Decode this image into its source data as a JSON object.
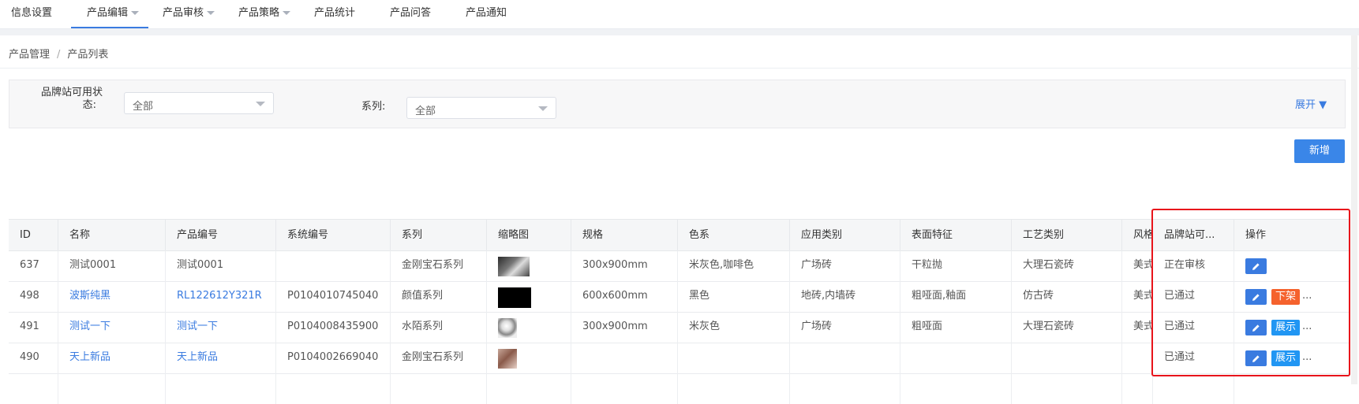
{
  "nav": {
    "items": [
      {
        "label": "信息设置",
        "caret": false,
        "active": false
      },
      {
        "label": "产品编辑",
        "caret": true,
        "active": true
      },
      {
        "label": "产品审核",
        "caret": true,
        "active": false
      },
      {
        "label": "产品策略",
        "caret": true,
        "active": false
      },
      {
        "label": "产品统计",
        "caret": false,
        "active": false
      },
      {
        "label": "产品问答",
        "caret": false,
        "active": false
      },
      {
        "label": "产品通知",
        "caret": false,
        "active": false
      }
    ]
  },
  "breadcrumb": {
    "root": "产品管理",
    "separator": "/",
    "current": "产品列表"
  },
  "filter": {
    "brand_status_label_line1": "品牌站可用状",
    "brand_status_label_line2": "态:",
    "brand_status_value": "全部",
    "series_label": "系列:",
    "series_value": "全部",
    "expand_label": "展开 ▼"
  },
  "toolbar": {
    "new_label": "新增"
  },
  "table": {
    "headers": [
      "ID",
      "名称",
      "产品编号",
      "系统编号",
      "系列",
      "缩略图",
      "规格",
      "色系",
      "应用类别",
      "表面特征",
      "工艺类别",
      "风格",
      "品牌站可...",
      "操作"
    ],
    "rows": [
      {
        "id": "637",
        "name": "测试0001",
        "code": "测试0001",
        "sys": "",
        "series": "金刚宝石系列",
        "thumb": "room",
        "spec": "300x900mm",
        "color": "米灰色,咖啡色",
        "app": "广场砖",
        "surface": "干粒抛",
        "craft": "大理石瓷砖",
        "style": "美式",
        "status": "正在审核",
        "link": false,
        "ops": []
      },
      {
        "id": "498",
        "name": "波斯纯黑",
        "code": "RL122612Y321R",
        "sys": "P0104010745040",
        "series": "颜值系列",
        "thumb": "black",
        "spec": "600x600mm",
        "color": "黑色",
        "app": "地砖,内墙砖",
        "surface": "粗哑面,釉面",
        "craft": "仿古砖",
        "style": "美式",
        "status": "已通过",
        "link": true,
        "ops": [
          {
            "label": "下架",
            "color": "#f5622d"
          }
        ]
      },
      {
        "id": "491",
        "name": "测试一下",
        "code": "测试一下",
        "sys": "P0104008435900",
        "series": "水陌系列",
        "thumb": "portrait",
        "spec": "300x900mm",
        "color": "米灰色",
        "app": "广场砖",
        "surface": "粗哑面",
        "craft": "大理石瓷砖",
        "style": "美式",
        "status": "已通过",
        "link": true,
        "ops": [
          {
            "label": "展示",
            "color": "#2196f3"
          }
        ]
      },
      {
        "id": "490",
        "name": "天上新品",
        "code": "天上新品",
        "sys": "P0104002669040",
        "series": "金刚宝石系列",
        "thumb": "food",
        "spec": "",
        "color": "",
        "app": "",
        "surface": "",
        "craft": "",
        "style": "",
        "status": "已通过",
        "link": true,
        "ops": [
          {
            "label": "展示",
            "color": "#2196f3"
          }
        ]
      }
    ],
    "more_label": "..."
  }
}
